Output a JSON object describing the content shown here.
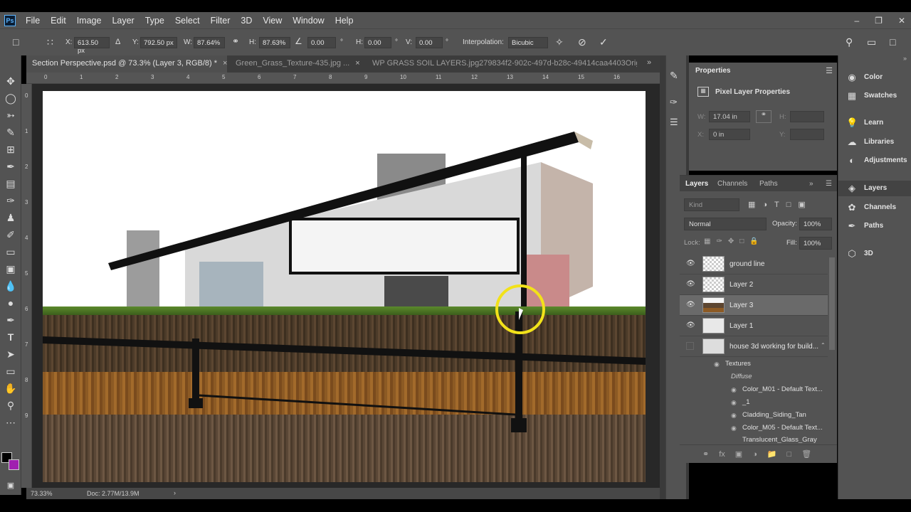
{
  "menu": [
    "File",
    "Edit",
    "Image",
    "Layer",
    "Type",
    "Select",
    "Filter",
    "3D",
    "View",
    "Window",
    "Help"
  ],
  "app_logo": "Ps",
  "options": {
    "x_label": "X:",
    "x_value": "613.50 px",
    "y_label": "Y:",
    "y_value": "792.50 px",
    "w_label": "W:",
    "w_value": "87.64%",
    "h_label": "H:",
    "h_value": "87.63%",
    "angle_value": "0.00",
    "deg": "°",
    "hskew_label": "H:",
    "hskew_value": "0.00",
    "vskew_label": "V:",
    "vskew_value": "0.00",
    "interp_label": "Interpolation:",
    "interp_value": "Bicubic"
  },
  "tabs": [
    {
      "label": "Section Perspective.psd @ 73.3% (Layer 3, RGB/8) *",
      "active": true
    },
    {
      "label": "Green_Grass_Texture-435.jpg ...",
      "active": false
    },
    {
      "label": "WP GRASS SOIL LAYERS.jpg279834f2-902c-497d-b28c-49414caa4403Origina",
      "active": false
    }
  ],
  "ruler_top": [
    "0",
    "1",
    "2",
    "3",
    "4",
    "5",
    "6",
    "7",
    "8",
    "9",
    "10",
    "11",
    "12",
    "13",
    "14",
    "15",
    "16"
  ],
  "ruler_left": [
    "0",
    "1",
    "2",
    "3",
    "4",
    "5",
    "6",
    "7",
    "8",
    "9"
  ],
  "status": {
    "zoom": "73.33%",
    "doc": "Doc: 2.77M/13.9M"
  },
  "properties": {
    "tab": "Properties",
    "title": "Pixel Layer Properties",
    "w_label": "W:",
    "w_value": "17.04 in",
    "h_label": "H:",
    "h_value": "",
    "x_label": "X:",
    "x_value": "0 in",
    "y_label": "Y:",
    "y_value": ""
  },
  "layers_panel": {
    "tabs": [
      "Layers",
      "Channels",
      "Paths"
    ],
    "kind_placeholder": "Kind",
    "blend_mode": "Normal",
    "opacity_label": "Opacity:",
    "opacity_value": "100%",
    "lock_label": "Lock:",
    "fill_label": "Fill:",
    "fill_value": "100%",
    "layers": [
      {
        "name": "ground line",
        "visible": true,
        "selected": false
      },
      {
        "name": "Layer 2",
        "visible": true,
        "selected": false
      },
      {
        "name": "Layer 3",
        "visible": true,
        "selected": true
      },
      {
        "name": "Layer 1",
        "visible": true,
        "selected": false
      },
      {
        "name": "house 3d working for build...",
        "visible": false,
        "selected": false
      }
    ],
    "effects_header": "Textures",
    "effects_sub": "Diffuse",
    "textures": [
      "Color_M01 - Default Text...",
      "_1",
      "Cladding_Siding_Tan",
      "Color_M05 - Default Text...",
      "Translucent_Glass_Gray"
    ]
  },
  "right_panels": [
    {
      "label": "Color",
      "icon": "color-wheel-icon"
    },
    {
      "label": "Swatches",
      "icon": "swatches-grid-icon"
    },
    {
      "label": "Learn",
      "icon": "lightbulb-icon"
    },
    {
      "label": "Libraries",
      "icon": "libraries-cloud-icon"
    },
    {
      "label": "Adjustments",
      "icon": "adjustments-circle-icon"
    },
    {
      "label": "Layers",
      "icon": "layers-stack-icon"
    },
    {
      "label": "Channels",
      "icon": "channels-icon"
    },
    {
      "label": "Paths",
      "icon": "pen-path-icon"
    },
    {
      "label": "3D",
      "icon": "3d-cube-icon"
    }
  ],
  "colors": {
    "accent_highlight": "#f2e21a",
    "foreground": "#000000",
    "background": "#a020b0"
  }
}
